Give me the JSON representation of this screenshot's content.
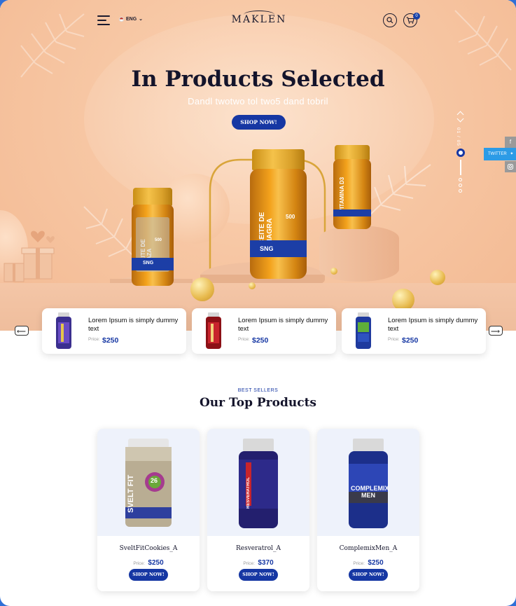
{
  "header": {
    "language": "ENG",
    "brand": "MAKLEN",
    "cart_count": "0"
  },
  "hero": {
    "title": "In Products Selected",
    "subtitle": "Dandl twotwo tol two5 dand tobril",
    "cta": "SHOP NOW!",
    "slide_counter": "01 / 05",
    "jars": [
      {
        "text": "ACEITE DE LINAZA",
        "number": "500"
      },
      {
        "text": "ACEITE DE ONAGRA",
        "number": "500"
      },
      {
        "text": "VITAMINA D3",
        "number": ""
      }
    ],
    "jar_brand": "SNG"
  },
  "social": {
    "twitter": "TWITTER",
    "facebook_icon": "f",
    "instagram_icon": "instagram-icon"
  },
  "featured": [
    {
      "title": "Lorem Ipsum is simply dummy text",
      "price_label": "Price:",
      "price": "$250",
      "bottle_color": "#3b2f8f",
      "label_color": "#6a4cc4"
    },
    {
      "title": "Lorem Ipsum is simply dummy text",
      "price_label": "Price:",
      "price": "$250",
      "bottle_color": "#8c1016",
      "label_color": "#c8242c"
    },
    {
      "title": "Lorem Ipsum is simply dummy text",
      "price_label": "Price:",
      "price": "$250",
      "bottle_color": "#1f3a9e",
      "label_color": "#5fae3a"
    }
  ],
  "best_sellers": {
    "kicker": "BEST SELLERS",
    "title": "Our Top Products",
    "products": [
      {
        "name": "SveltFitCookies_A",
        "price_label": "Price:",
        "price": "$250",
        "cta": "SHOP NOW!",
        "label": "SVELT FIT",
        "badge": "26"
      },
      {
        "name": "Resveratrol_A",
        "price_label": "Price:",
        "price": "$370",
        "cta": "SHOP NOW!",
        "label": "RESVERATROL",
        "badge": ""
      },
      {
        "name": "ComplemixMen_A",
        "price_label": "Price:",
        "price": "$250",
        "cta": "SHOP NOW!",
        "label": "COMPLEMIX MEN",
        "badge": ""
      }
    ]
  },
  "colors": {
    "accent": "#1637a3",
    "hero_bg": "#f7c7a4"
  }
}
